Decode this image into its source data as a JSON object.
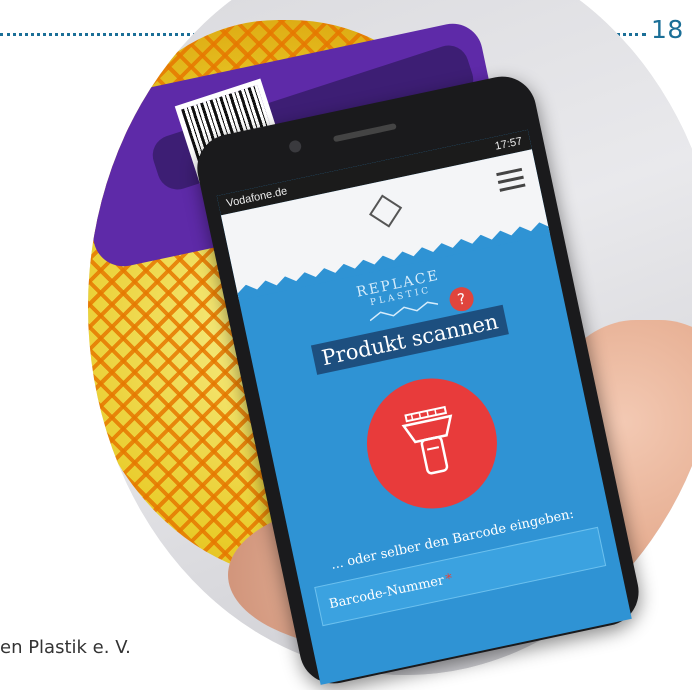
{
  "page": {
    "number": "18",
    "caption": "en Plastik e. V."
  },
  "phone": {
    "status": {
      "carrier": "Vodafone.de",
      "time": "17:57"
    },
    "app": {
      "brand_line1": "REPLACE",
      "brand_line2": "PLASTIC",
      "title": "Produkt scannen",
      "help_symbol": "?",
      "or_text": "... oder selber den Barcode eingeben:",
      "input_placeholder": "Barcode-Nummer",
      "required_marker": "*"
    }
  },
  "colors": {
    "accent_blue": "#2f93d4",
    "scan_button": "#e83b3b",
    "title_bg": "#1d4f7f",
    "page_number": "#1b6f97"
  },
  "icons": [
    "menu-icon",
    "logo-icon",
    "help-icon",
    "barcode-scanner-icon"
  ]
}
